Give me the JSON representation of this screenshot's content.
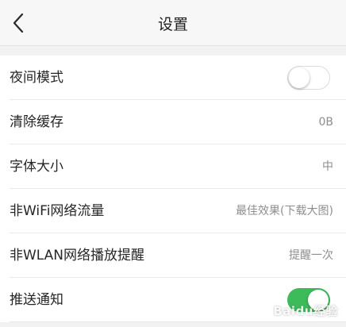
{
  "header": {
    "title": "设置",
    "back_icon": "chevron-left-icon"
  },
  "settings": [
    {
      "label": "夜间模式",
      "control": "toggle",
      "state": "off"
    },
    {
      "label": "清除缓存",
      "value": "0B"
    },
    {
      "label": "字体大小",
      "value": "中"
    },
    {
      "label": "非WiFi网络流量",
      "value": "最佳效果(下载大图)"
    },
    {
      "label": "非WLAN网络播放提醒",
      "value": "提醒一次"
    },
    {
      "label": "推送通知",
      "control": "toggle",
      "state": "on"
    }
  ],
  "colors": {
    "toggle_on": "#3dbb5a",
    "toggle_off": "#ffffff"
  },
  "watermark": "Baidu经验"
}
